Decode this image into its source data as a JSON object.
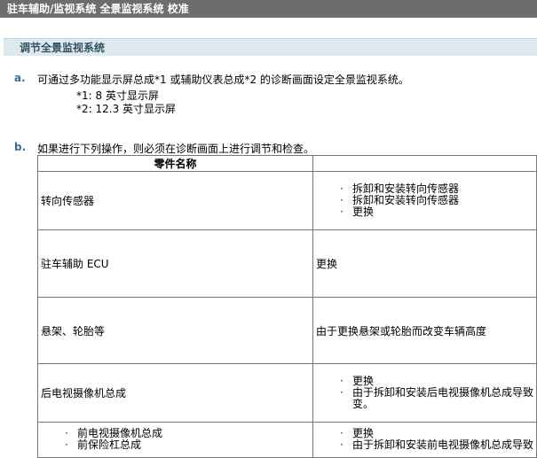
{
  "header": {
    "title": "驻车辅助/监视系统  全景监视系统  校准"
  },
  "section": {
    "title": "调节全景监视系统"
  },
  "steps": {
    "a": {
      "letter": "a.",
      "text": "可通过多功能显示屏总成*1 或辅助仪表总成*2 的诊断画面设定全景监视系统。",
      "notes": [
        "*1:  8 英寸显示屏",
        "*2:  12.3 英寸显示屏"
      ]
    },
    "b": {
      "letter": "b.",
      "text": "如果进行下列操作，则必须在诊断画面上进行调节和检查。"
    }
  },
  "table": {
    "header": "零件名称",
    "rows": [
      {
        "part": "转向传感器",
        "ops": [
          "拆卸和安装转向传感器",
          "拆卸和安装转向传感器",
          "更换"
        ]
      },
      {
        "part": "驻车辅助  ECU",
        "op": "更换"
      },
      {
        "part": "悬架、轮胎等",
        "op": "由于更换悬架或轮胎而改变车辆高度"
      },
      {
        "part": "后电视摄像机总成",
        "ops": [
          "更换",
          "由于拆卸和安装后电视摄像机总成导致"
        ],
        "ops_cont": "变。"
      },
      {
        "parts": [
          "前电视摄像机总成",
          "前保险杠总成"
        ],
        "ops": [
          "更换",
          "由于拆卸和安装前电视摄像机总成导致"
        ]
      }
    ]
  }
}
